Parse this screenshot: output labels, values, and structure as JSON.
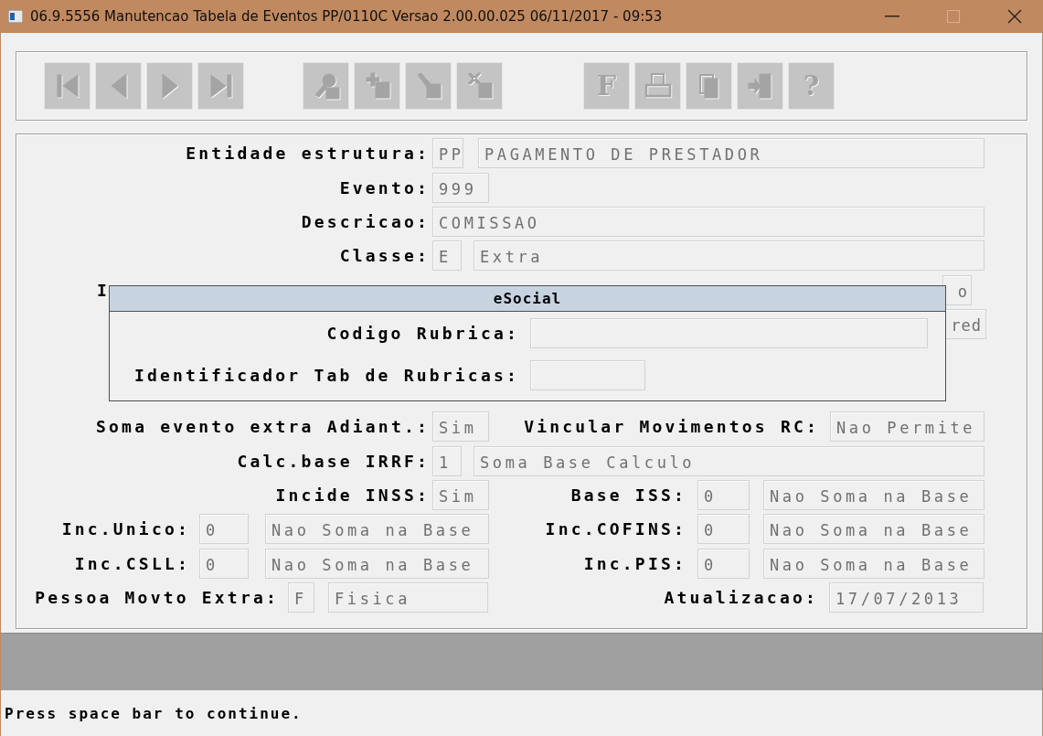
{
  "window": {
    "title": "06.9.5556 Manutencao  Tabela de Eventos PP/0110C Versao 2.00.00.025 06/11/2017 - 09:53"
  },
  "toolbar": [
    {
      "kind": "first",
      "disabled": true
    },
    {
      "kind": "prev",
      "disabled": true
    },
    {
      "kind": "next",
      "disabled": true
    },
    {
      "kind": "last",
      "disabled": true
    },
    {
      "kind": "key",
      "disabled": true
    },
    {
      "kind": "add",
      "disabled": true
    },
    {
      "kind": "edit",
      "disabled": true
    },
    {
      "kind": "delete",
      "disabled": true
    },
    {
      "kind": "glyph",
      "glyph": "F",
      "disabled": true
    },
    {
      "kind": "print",
      "disabled": true
    },
    {
      "kind": "copy",
      "disabled": true
    },
    {
      "kind": "exit",
      "disabled": true
    },
    {
      "kind": "glyph",
      "glyph": "?",
      "disabled": true
    }
  ],
  "form": {
    "entidade_estrutura": {
      "label": "Entidade estrutura:",
      "code": "PP",
      "name": "PAGAMENTO DE PRESTADOR"
    },
    "evento": {
      "label": "Evento:",
      "value": "999"
    },
    "descricao": {
      "label": "Descricao:",
      "value": "COMISSAO"
    },
    "classe": {
      "label": "Classe:",
      "code": "E",
      "name": "Extra"
    },
    "covered_row_1": {
      "label": "I",
      "value": "o"
    },
    "covered_row_2": {
      "value": "red"
    },
    "soma_evento_extra": {
      "label": "Soma evento extra Adiant.:",
      "value": "Sim"
    },
    "vincular_movimentos": {
      "label": "Vincular Movimentos RC:",
      "value": "Nao Permite"
    },
    "calc_base_irrf": {
      "label": "Calc.base IRRF:",
      "code": "1",
      "name": "Soma Base Calculo"
    },
    "incide_inss": {
      "label": "Incide INSS:",
      "value": "Sim"
    },
    "base_iss": {
      "label": "Base ISS:",
      "code": "0",
      "name": "Nao Soma na Base"
    },
    "inc_unico": {
      "label": "Inc.Unico:",
      "code": "0",
      "name": "Nao Soma na Base"
    },
    "inc_cofins": {
      "label": "Inc.COFINS:",
      "code": "0",
      "name": "Nao Soma na Base"
    },
    "inc_csll": {
      "label": "Inc.CSLL:",
      "code": "0",
      "name": "Nao Soma na Base"
    },
    "inc_pis": {
      "label": "Inc.PIS:",
      "code": "0",
      "name": "Nao Soma na Base"
    },
    "pessoa_movto_extra": {
      "label": "Pessoa Movto Extra:",
      "code": "F",
      "name": "Fisica"
    },
    "atualizacao": {
      "label": "Atualizacao:",
      "value": "17/07/2013"
    }
  },
  "dialog": {
    "title": "eSocial",
    "fields": [
      {
        "label": "Codigo Rubrica:"
      },
      {
        "label": "Identificador Tab de Rubricas:"
      }
    ]
  },
  "status_bar": "Press space bar to continue."
}
